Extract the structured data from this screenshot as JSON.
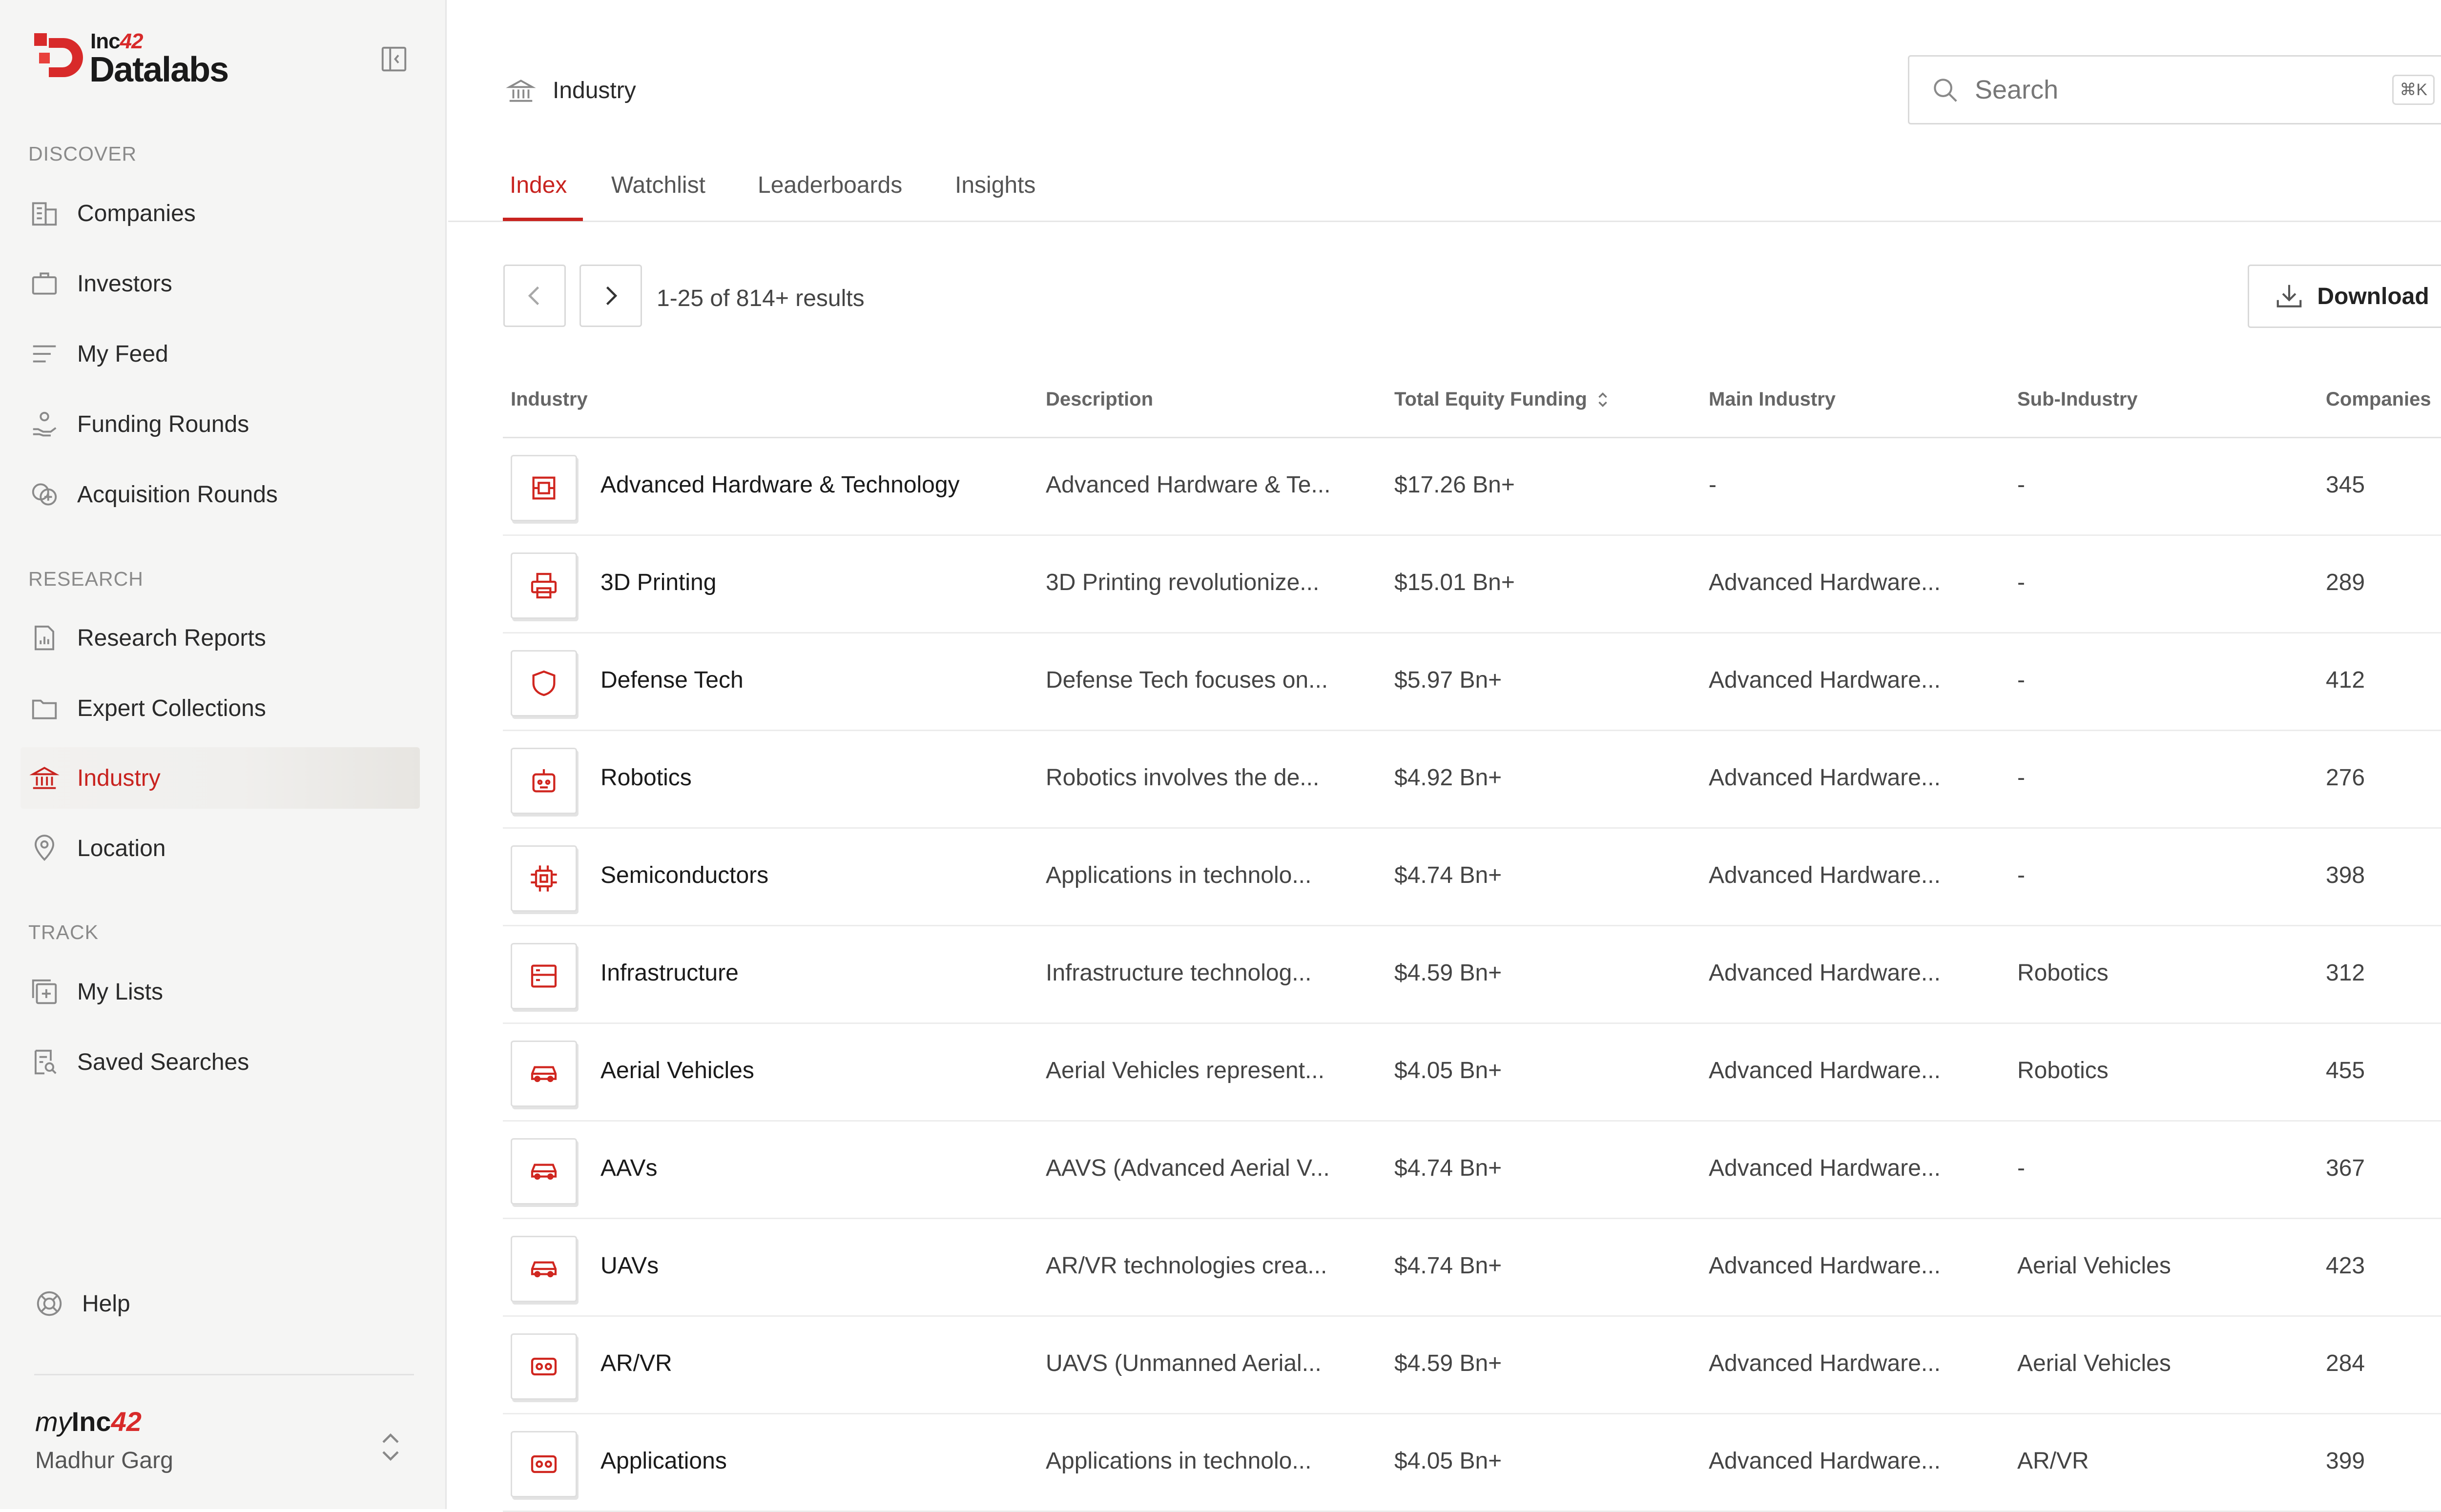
{
  "brand": {
    "inc": "Inc",
    "n42": "42",
    "name": "Datalabs"
  },
  "sidebar": {
    "sections": [
      {
        "title": "DISCOVER"
      },
      {
        "title": "RESEARCH"
      },
      {
        "title": "TRACK"
      }
    ],
    "items": [
      {
        "label": "Companies",
        "icon": "building-icon"
      },
      {
        "label": "Investors",
        "icon": "briefcase-icon"
      },
      {
        "label": "My Feed",
        "icon": "feed-lines-icon"
      },
      {
        "label": "Funding Rounds",
        "icon": "funding-hand-icon"
      },
      {
        "label": "Acquisition Rounds",
        "icon": "coins-plus-icon"
      },
      {
        "label": "Research Reports",
        "icon": "report-doc-icon"
      },
      {
        "label": "Expert Collections",
        "icon": "folder-icon"
      },
      {
        "label": "Industry",
        "icon": "bank-icon",
        "active": true
      },
      {
        "label": "Location",
        "icon": "map-pin-icon"
      },
      {
        "label": "My Lists",
        "icon": "list-plus-icon"
      },
      {
        "label": "Saved Searches",
        "icon": "saved-search-icon"
      }
    ],
    "help": "Help",
    "account": {
      "my": "my",
      "inc": "Inc",
      "n42": "42",
      "user": "Madhur Garg"
    }
  },
  "header": {
    "breadcrumb": "Industry",
    "search_placeholder": "Search",
    "search_shortcut": "⌘K"
  },
  "tabs": [
    {
      "label": "Index",
      "active": true
    },
    {
      "label": "Watchlist"
    },
    {
      "label": "Leaderboards"
    },
    {
      "label": "Insights"
    }
  ],
  "toolbar": {
    "results": "1-25 of 814+ results",
    "download": "Download"
  },
  "table": {
    "columns": [
      "Industry",
      "Description",
      "Total Equity Funding",
      "Main Industry",
      "Sub-Industry",
      "Companies"
    ],
    "rows": [
      {
        "icon": "hardware-chip-icon",
        "industry": "Advanced Hardware & Technology",
        "description": "Advanced Hardware & Te...",
        "funding": "$17.26 Bn+",
        "main": "-",
        "sub": "-",
        "companies": "345"
      },
      {
        "icon": "printer-icon",
        "industry": "3D Printing",
        "description": "3D Printing revolutionize...",
        "funding": "$15.01 Bn+",
        "main": "Advanced Hardware...",
        "sub": "-",
        "companies": "289"
      },
      {
        "icon": "shield-icon",
        "industry": "Defense Tech",
        "description": "Defense Tech focuses on...",
        "funding": "$5.97 Bn+",
        "main": "Advanced Hardware...",
        "sub": "-",
        "companies": "412"
      },
      {
        "icon": "robot-icon",
        "industry": "Robotics",
        "description": "Robotics involves the de...",
        "funding": "$4.92 Bn+",
        "main": "Advanced Hardware...",
        "sub": "-",
        "companies": "276"
      },
      {
        "icon": "cpu-icon",
        "industry": "Semiconductors",
        "description": "Applications in technolo...",
        "funding": "$4.74 Bn+",
        "main": "Advanced Hardware...",
        "sub": "-",
        "companies": "398"
      },
      {
        "icon": "server-icon",
        "industry": "Infrastructure",
        "description": "Infrastructure technolog...",
        "funding": "$4.59 Bn+",
        "main": "Advanced Hardware...",
        "sub": "Robotics",
        "companies": "312"
      },
      {
        "icon": "car-icon",
        "industry": "Aerial Vehicles",
        "description": "Aerial Vehicles represent...",
        "funding": "$4.05 Bn+",
        "main": "Advanced Hardware...",
        "sub": "Robotics",
        "companies": "455"
      },
      {
        "icon": "car-icon",
        "industry": "AAVs",
        "description": "AAVS (Advanced Aerial V...",
        "funding": "$4.74 Bn+",
        "main": "Advanced Hardware...",
        "sub": "-",
        "companies": "367"
      },
      {
        "icon": "car-icon",
        "industry": "UAVs",
        "description": "AR/VR technologies crea...",
        "funding": "$4.74 Bn+",
        "main": "Advanced Hardware...",
        "sub": "Aerial Vehicles",
        "companies": "423"
      },
      {
        "icon": "vr-headset-icon",
        "industry": "AR/VR",
        "description": "UAVS (Unmanned Aerial...",
        "funding": "$4.59 Bn+",
        "main": "Advanced Hardware...",
        "sub": "Aerial Vehicles",
        "companies": "284"
      },
      {
        "icon": "vr-headset-icon",
        "industry": "Applications",
        "description": "Applications in technolo...",
        "funding": "$4.05 Bn+",
        "main": "Advanced Hardware...",
        "sub": "AR/VR",
        "companies": "399"
      }
    ]
  },
  "colors": {
    "accent": "#c8231f",
    "brand_red": "#d82a2a",
    "sidebar_bg": "#f5f5f4"
  }
}
